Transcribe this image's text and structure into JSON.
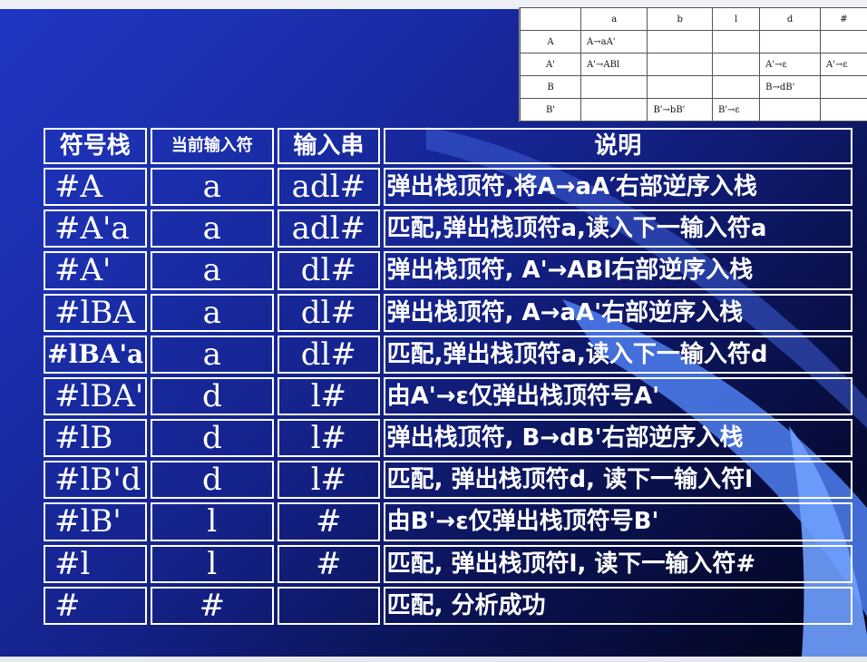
{
  "parse_table": {
    "headers": [
      "",
      "a",
      "b",
      "l",
      "d",
      "#"
    ],
    "rows": [
      [
        "A",
        "A→aA'",
        "",
        "",
        "",
        ""
      ],
      [
        "A'",
        "A'→ABl",
        "",
        "",
        "A'→ε",
        "A'→ε"
      ],
      [
        "B",
        "",
        "",
        "",
        "B→dB'",
        ""
      ],
      [
        "B'",
        "",
        "B'→bB'",
        "B'→ε",
        "",
        ""
      ]
    ]
  },
  "trace_table": {
    "headers": [
      "符号栈",
      "当前输入符",
      "输入串",
      "说明"
    ],
    "rows": [
      [
        "#A",
        "a",
        "adl#",
        "弹出栈顶符,将A→aA′右部逆序入栈"
      ],
      [
        "#A'a",
        "a",
        "adl#",
        "匹配,弹出栈顶符a,读入下一输入符a"
      ],
      [
        "#A'",
        "a",
        "dl#",
        "弹出栈顶符, A'→ABl右部逆序入栈"
      ],
      [
        "#lBA",
        "a",
        "dl#",
        "弹出栈顶符, A→aA'右部逆序入栈"
      ],
      [
        "#lBA'a",
        "a",
        "dl#",
        "匹配,弹出栈顶符a,读入下一输入符d"
      ],
      [
        "#lBA'",
        "d",
        "l#",
        "由A'→ε仅弹出栈顶符号A'"
      ],
      [
        "#lB",
        "d",
        "l#",
        "弹出栈顶符, B→dB'右部逆序入栈"
      ],
      [
        "#lB'd",
        "d",
        "l#",
        "匹配, 弹出栈顶符d, 读下一输入符l"
      ],
      [
        "#lB'",
        "l",
        "#",
        "由B'→ε仅弹出栈顶符号B'"
      ],
      [
        "#l",
        "l",
        "#",
        "匹配, 弹出栈顶符l, 读下一输入符#"
      ],
      [
        "#",
        "#",
        "",
        "匹配, 分析成功"
      ]
    ]
  },
  "colors": {
    "background_top": "#1f36c4",
    "background_bottom": "#02041a",
    "wave_light": "#5a8cf0",
    "text": "#ffffff"
  }
}
